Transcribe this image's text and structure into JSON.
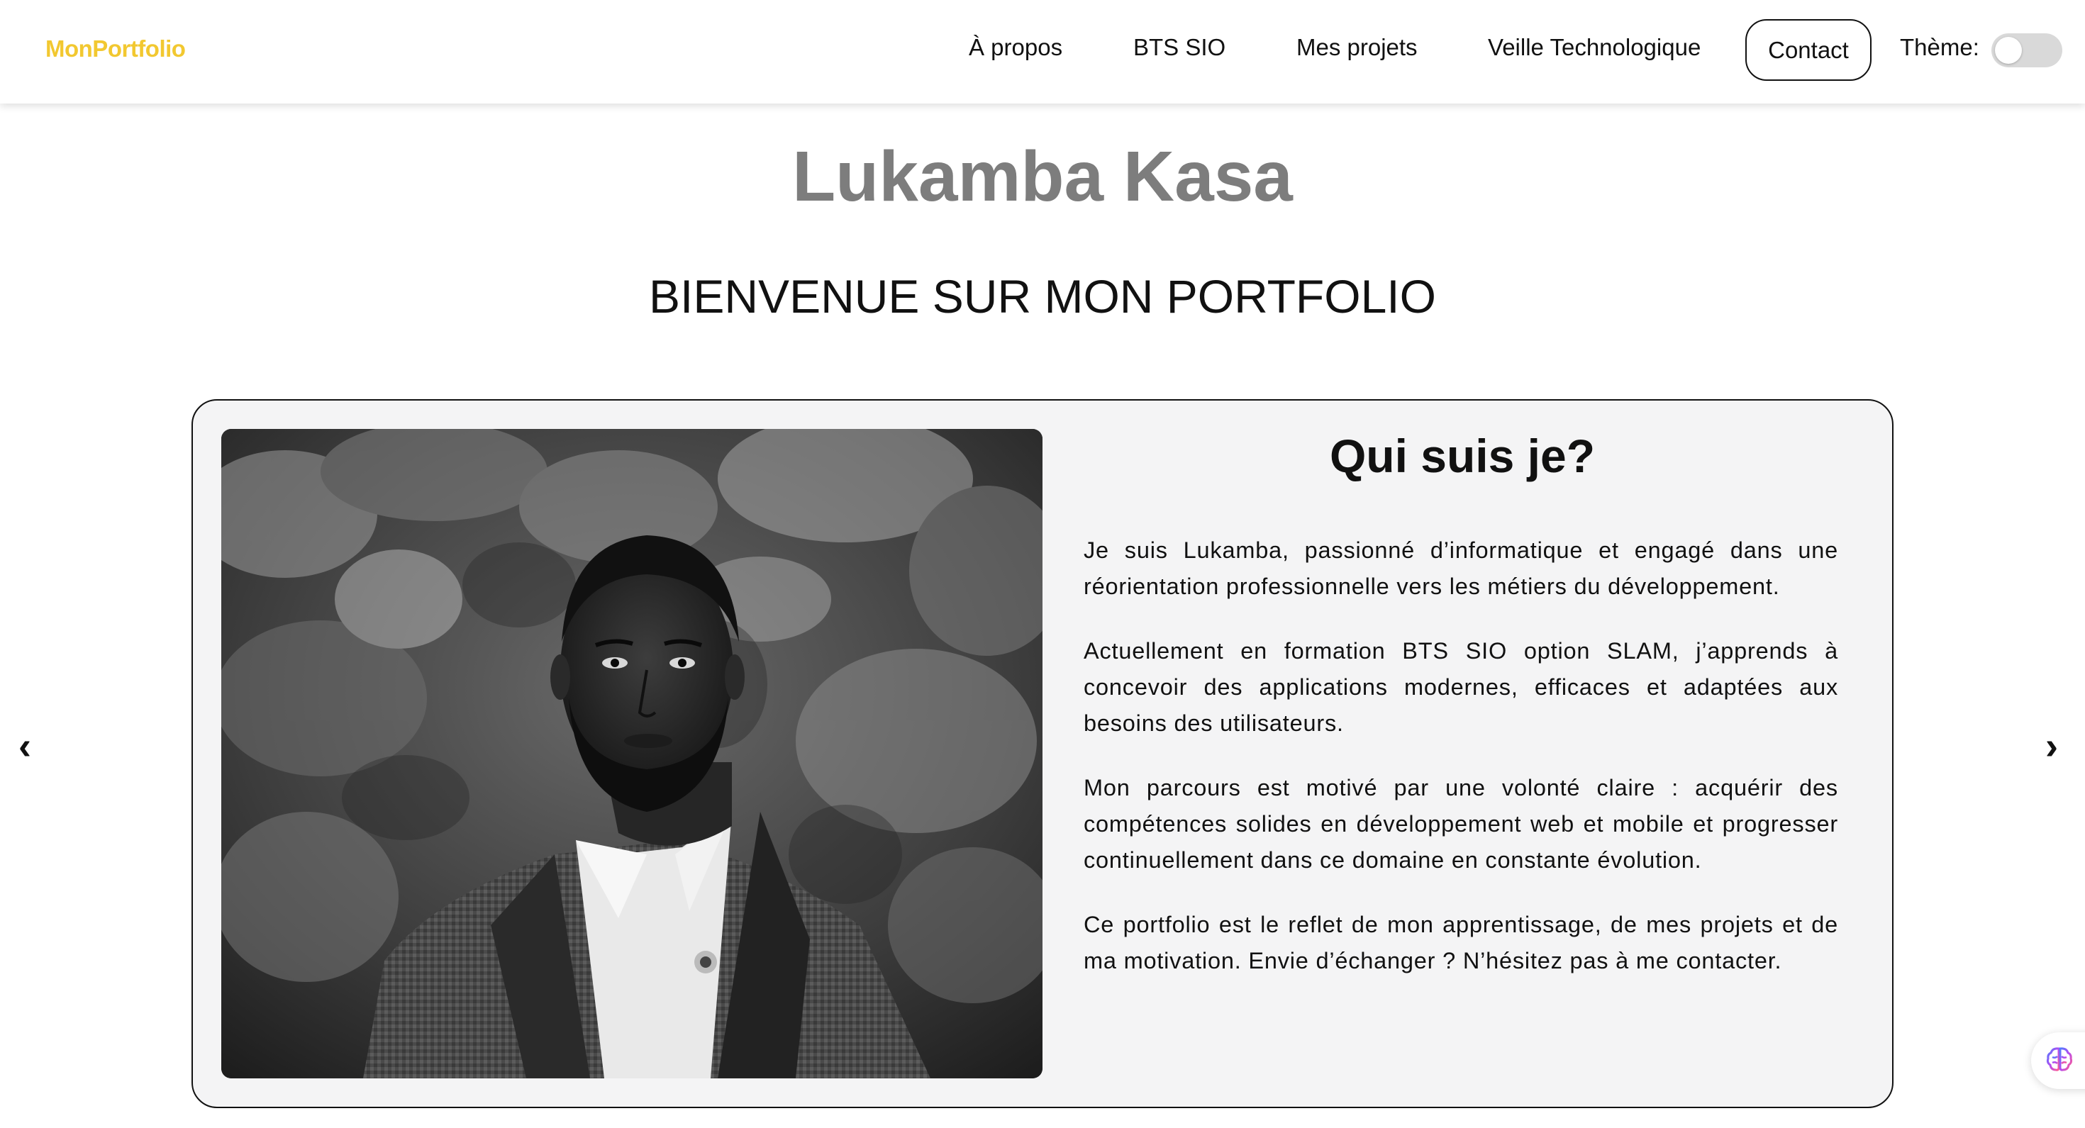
{
  "navbar": {
    "brand": "MonPortfolio",
    "links": [
      "À propos",
      "BTS SIO",
      "Mes projets",
      "Veille Technologique"
    ],
    "contact": "Contact",
    "theme_label": "Thème:",
    "theme_dark_enabled": false
  },
  "hero": {
    "name": "Lukamba Kasa",
    "welcome": "BIENVENUE SUR MON PORTFOLIO"
  },
  "carousel": {
    "prev_icon": "‹",
    "next_icon": "›",
    "slide": {
      "title": "Qui suis je?",
      "paragraphs": [
        "Je suis Lukamba, passionné d’informatique et engagé dans une réorientation professionnelle vers les métiers du développement.",
        "Actuellement en formation BTS SIO option SLAM, j’apprends à concevoir des applications modernes, efficaces et adaptées aux besoins des utilisateurs.",
        "Mon parcours est motivé par une volonté claire : acquérir des compétences solides en développement web et mobile et progresser continuellement dans ce domaine en constante évolution.",
        "Ce portfolio est le reflet de mon apprentissage, de mes projets et de ma motivation. Envie d’échanger ? N’hésitez pas à me contacter."
      ]
    }
  },
  "colors": {
    "brand": "#f2c830",
    "name_gray": "#7d7d7d",
    "card_bg": "#f4f4f5"
  }
}
